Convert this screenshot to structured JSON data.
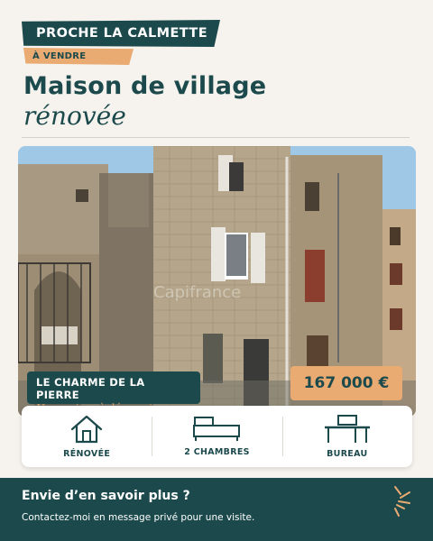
{
  "header": {
    "location": "PROCHE LA CALMETTE",
    "status_tag": "À VENDRE",
    "title_line1": "Maison de village",
    "title_line2": "rénovée"
  },
  "photo": {
    "watermark": "Capifrance"
  },
  "charm": {
    "title": "LE CHARME DE LA PIERRE",
    "subtitle": "Une maison à découvrir"
  },
  "price": "167 000 €",
  "features": [
    {
      "icon": "house-icon",
      "label": "RÉNOVÉE"
    },
    {
      "icon": "bed-icon",
      "label": "2 CHAMBRES"
    },
    {
      "icon": "desk-icon",
      "label": "BUREAU"
    }
  ],
  "footer": {
    "title": "Envie d’en savoir plus ?",
    "text": "Contactez-moi en message privé pour une visite."
  },
  "colors": {
    "teal": "#1c4a4c",
    "orange": "#e9ab72",
    "background": "#f6f3ee"
  }
}
